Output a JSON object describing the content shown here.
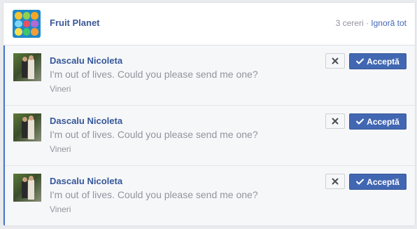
{
  "header": {
    "app_title": "Fruit Planet",
    "request_count": "3 cereri",
    "separator": "·",
    "ignore_all": "Ignoră tot"
  },
  "requests": [
    {
      "name": "Dascalu Nicoleta",
      "message": "I'm out of lives. Could you please send me one?",
      "date": "Vineri",
      "accept_label": "Acceptă"
    },
    {
      "name": "Dascalu Nicoleta",
      "message": "I'm out of lives. Could you please send me one?",
      "date": "Vineri",
      "accept_label": "Acceptă"
    },
    {
      "name": "Dascalu Nicoleta",
      "message": "I'm out of lives. Could you please send me one?",
      "date": "Vineri",
      "accept_label": "Acceptă"
    }
  ],
  "icons": {
    "app": "fruit-grid-icon",
    "dismiss": "close-icon",
    "accept": "checkmark-icon"
  },
  "colors": {
    "accent": "#4267b2",
    "link": "#365899",
    "muted": "#90949c",
    "highlight_bar": "#4a76c7"
  }
}
